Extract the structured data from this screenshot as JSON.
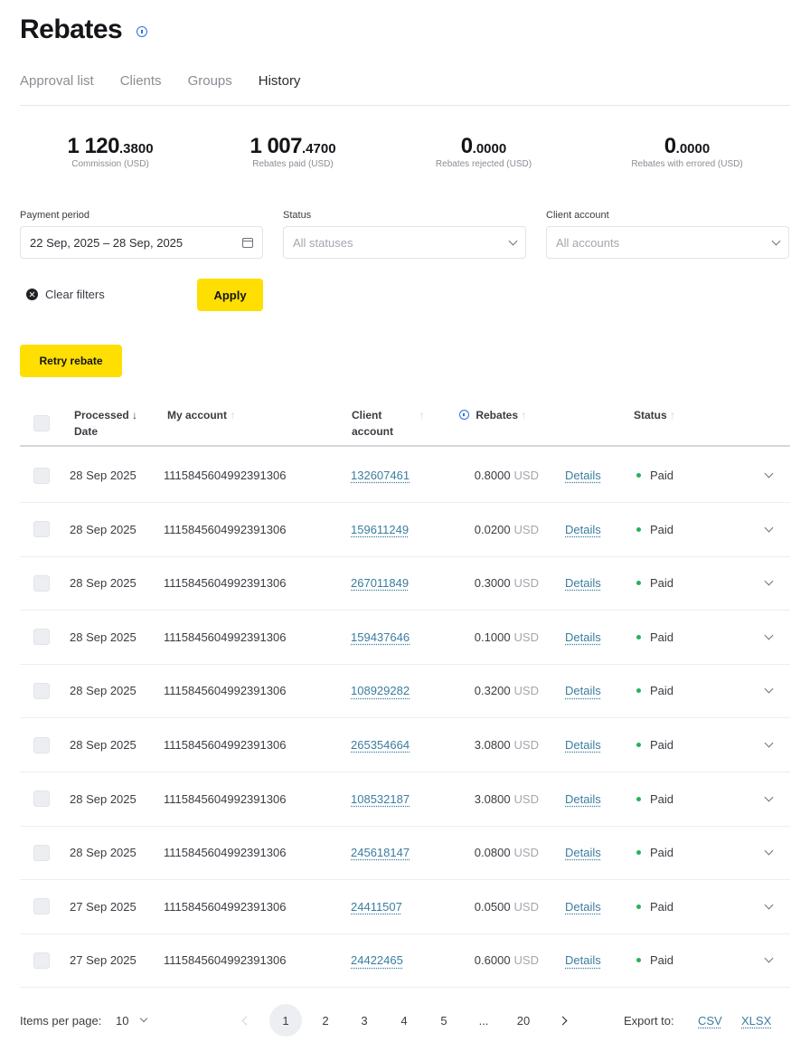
{
  "page": {
    "title": "Rebates"
  },
  "tabs": [
    {
      "label": "Approval list"
    },
    {
      "label": "Clients"
    },
    {
      "label": "Groups"
    },
    {
      "label": "History"
    }
  ],
  "stats": [
    {
      "int": "1 120",
      "dec": ".3800",
      "label": "Commission (USD)"
    },
    {
      "int": "1 007",
      "dec": ".4700",
      "label": "Rebates paid (USD)"
    },
    {
      "int": "0",
      "dec": ".0000",
      "label": "Rebates rejected (USD)"
    },
    {
      "int": "0",
      "dec": ".0000",
      "label": "Rebates with errored (USD)"
    }
  ],
  "filters": {
    "payment_period": {
      "label": "Payment period",
      "value": "22 Sep, 2025 – 28 Sep, 2025"
    },
    "status": {
      "label": "Status",
      "placeholder": "All statuses"
    },
    "client_account": {
      "label": "Client account",
      "placeholder": "All accounts"
    },
    "clear_label": "Clear filters",
    "apply_label": "Apply"
  },
  "retry_label": "Retry rebate",
  "table": {
    "headers": {
      "processed": "Processed",
      "processed_arrow": "↓",
      "date": "Date",
      "my_account": "My account",
      "client": "Client",
      "account": "account",
      "rebates": "Rebates",
      "status": "Status",
      "sort_faded": "↑"
    },
    "rows": [
      {
        "date": "28 Sep 2025",
        "my_account": "1115845604992391306",
        "client": "132607461",
        "rebate": "0.8000",
        "currency": "USD",
        "details": "Details",
        "status": "Paid"
      },
      {
        "date": "28 Sep 2025",
        "my_account": "1115845604992391306",
        "client": "159611249",
        "rebate": "0.0200",
        "currency": "USD",
        "details": "Details",
        "status": "Paid"
      },
      {
        "date": "28 Sep 2025",
        "my_account": "1115845604992391306",
        "client": "267011849",
        "rebate": "0.3000",
        "currency": "USD",
        "details": "Details",
        "status": "Paid"
      },
      {
        "date": "28 Sep 2025",
        "my_account": "1115845604992391306",
        "client": "159437646",
        "rebate": "0.1000",
        "currency": "USD",
        "details": "Details",
        "status": "Paid"
      },
      {
        "date": "28 Sep 2025",
        "my_account": "1115845604992391306",
        "client": "108929282",
        "rebate": "0.3200",
        "currency": "USD",
        "details": "Details",
        "status": "Paid"
      },
      {
        "date": "28 Sep 2025",
        "my_account": "1115845604992391306",
        "client": "265354664",
        "rebate": "3.0800",
        "currency": "USD",
        "details": "Details",
        "status": "Paid"
      },
      {
        "date": "28 Sep 2025",
        "my_account": "1115845604992391306",
        "client": "108532187",
        "rebate": "3.0800",
        "currency": "USD",
        "details": "Details",
        "status": "Paid"
      },
      {
        "date": "28 Sep 2025",
        "my_account": "1115845604992391306",
        "client": "245618147",
        "rebate": "0.0800",
        "currency": "USD",
        "details": "Details",
        "status": "Paid"
      },
      {
        "date": "27 Sep 2025",
        "my_account": "1115845604992391306",
        "client": "24411507",
        "rebate": "0.0500",
        "currency": "USD",
        "details": "Details",
        "status": "Paid"
      },
      {
        "date": "27 Sep 2025",
        "my_account": "1115845604992391306",
        "client": "24422465",
        "rebate": "0.6000",
        "currency": "USD",
        "details": "Details",
        "status": "Paid"
      }
    ]
  },
  "pagination": {
    "items_per_page_label": "Items per page:",
    "items_per_page_value": "10",
    "pages": [
      "1",
      "2",
      "3",
      "4",
      "5",
      "...",
      "20"
    ],
    "current_page": "1",
    "export_label": "Export to:",
    "export_csv": "CSV",
    "export_xlsx": "XLSX"
  },
  "colors": {
    "accent_yellow": "#ffde02",
    "link": "#3b7d9e",
    "paid_dot": "#28b05a",
    "info_blue": "#2f6fdb"
  }
}
